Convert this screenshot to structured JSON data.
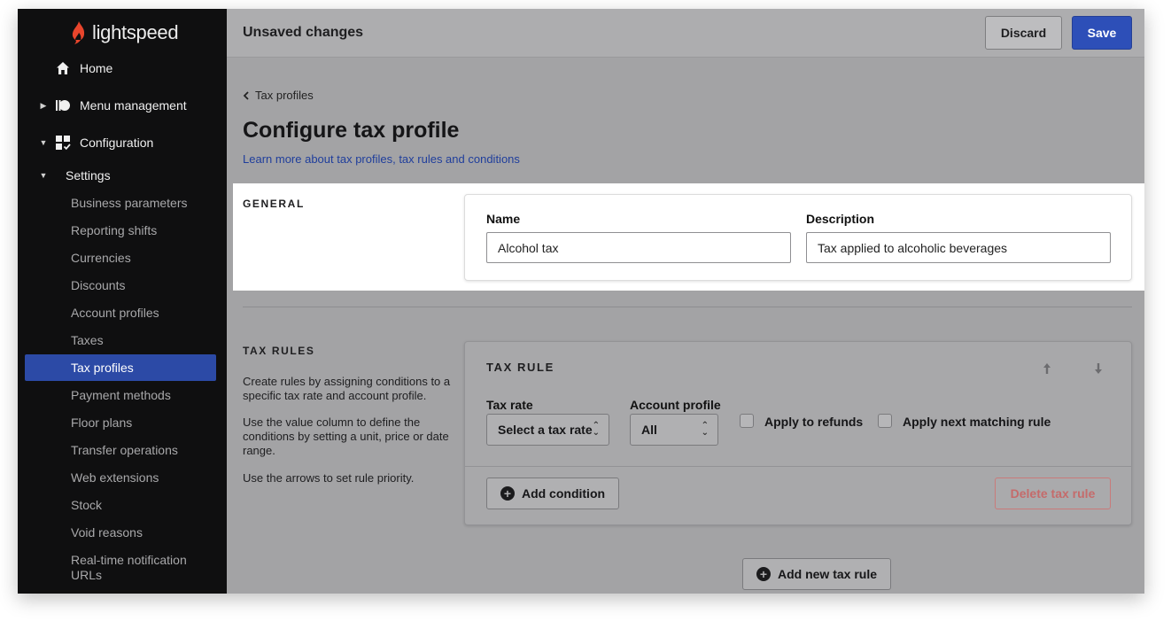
{
  "brand": {
    "name": "lightspeed",
    "color": "#e8452c"
  },
  "sidebar": {
    "top_items": [
      {
        "label": "Home",
        "icon": "home-icon"
      },
      {
        "label": "Menu management",
        "icon": "menu-management-icon"
      },
      {
        "label": "Configuration",
        "icon": "configuration-icon"
      }
    ],
    "settings_label": "Settings",
    "settings_items": [
      "Business parameters",
      "Reporting shifts",
      "Currencies",
      "Discounts",
      "Account profiles",
      "Taxes",
      "Tax profiles",
      "Payment methods",
      "Floor plans",
      "Transfer operations",
      "Web extensions",
      "Stock",
      "Void reasons",
      "Real-time notification URLs"
    ],
    "active_item": "Tax profiles",
    "active_color": "#2c4aa6"
  },
  "topbar": {
    "title": "Unsaved changes",
    "discard_label": "Discard",
    "save_label": "Save",
    "save_color": "#2d4fb8"
  },
  "page": {
    "back_label": "Tax profiles",
    "title": "Configure tax profile",
    "learn_more": "Learn more about tax profiles, tax rules and conditions"
  },
  "general": {
    "section_label": "GENERAL",
    "name_label": "Name",
    "name_value": "Alcohol tax",
    "description_label": "Description",
    "description_value": "Tax applied to alcoholic beverages"
  },
  "tax_rules": {
    "section_label": "TAX RULES",
    "help": [
      "Create rules by assigning conditions to a specific tax rate and account profile.",
      "Use the value column to define the conditions by setting a unit, price or date range.",
      "Use the arrows to set rule priority."
    ],
    "card_title": "TAX RULE",
    "tax_rate_label": "Tax rate",
    "tax_rate_value": "Select a tax rate",
    "account_profile_label": "Account profile",
    "account_profile_value": "All",
    "apply_refunds_label": "Apply to refunds",
    "apply_next_label": "Apply next matching rule",
    "add_condition_label": "Add condition",
    "delete_rule_label": "Delete tax rule",
    "add_new_rule_label": "Add new tax rule"
  }
}
